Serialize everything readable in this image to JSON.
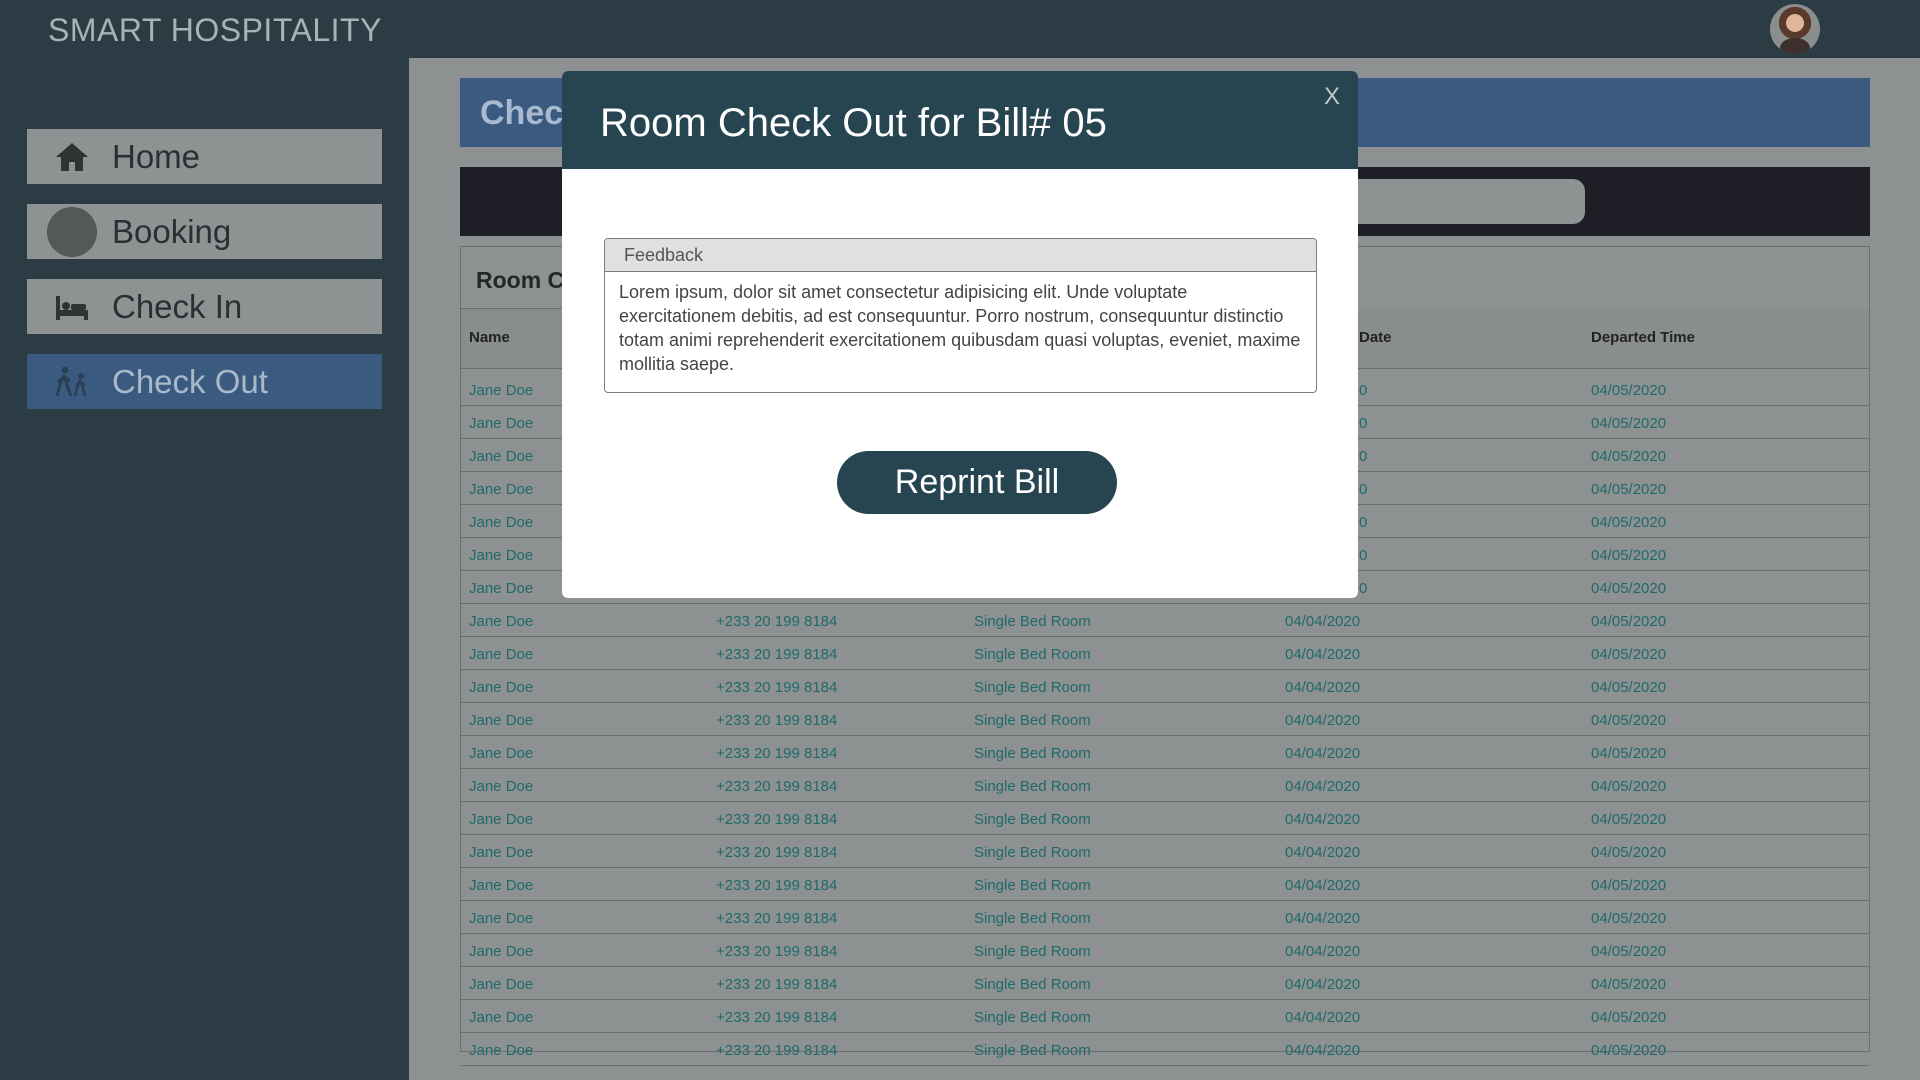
{
  "app": {
    "brand": "SMART HOSPITALITY"
  },
  "sidebar": {
    "items": [
      {
        "label": "Home",
        "icon": "home-icon",
        "active": false
      },
      {
        "label": "Booking",
        "icon": "circle-icon",
        "active": false
      },
      {
        "label": "Check In",
        "icon": "bed-icon",
        "active": false
      },
      {
        "label": "Check Out",
        "icon": "walking-icon",
        "active": true
      }
    ]
  },
  "main": {
    "header_title": "Chec",
    "card_tab": "Room C",
    "columns": [
      "Name",
      "Date",
      "Departed Time"
    ],
    "upper_rows": [
      {
        "name": "Jane Doe",
        "date_fragment": "0",
        "departed": "04/05/2020"
      },
      {
        "name": "Jane Doe",
        "date_fragment": "0",
        "departed": "04/05/2020"
      },
      {
        "name": "Jane Doe",
        "date_fragment": "0",
        "departed": "04/05/2020"
      },
      {
        "name": "Jane Doe",
        "date_fragment": "0",
        "departed": "04/05/2020"
      },
      {
        "name": "Jane Doe",
        "date_fragment": "0",
        "departed": "04/05/2020"
      },
      {
        "name": "Jane Doe",
        "date_fragment": "0",
        "departed": "04/05/2020"
      },
      {
        "name": "Jane Doe",
        "date_fragment": "0",
        "departed": "04/05/2020"
      }
    ],
    "rows": [
      {
        "name": "Jane Doe",
        "phone": "+233 20 199 8184",
        "room": "Single Bed Room",
        "date": "04/04/2020",
        "departed": "04/05/2020"
      },
      {
        "name": "Jane Doe",
        "phone": "+233 20 199 8184",
        "room": "Single Bed Room",
        "date": "04/04/2020",
        "departed": "04/05/2020"
      },
      {
        "name": "Jane Doe",
        "phone": "+233 20 199 8184",
        "room": "Single Bed Room",
        "date": "04/04/2020",
        "departed": "04/05/2020"
      },
      {
        "name": "Jane Doe",
        "phone": "+233 20 199 8184",
        "room": "Single Bed Room",
        "date": "04/04/2020",
        "departed": "04/05/2020"
      },
      {
        "name": "Jane Doe",
        "phone": "+233 20 199 8184",
        "room": "Single Bed Room",
        "date": "04/04/2020",
        "departed": "04/05/2020"
      },
      {
        "name": "Jane Doe",
        "phone": "+233 20 199 8184",
        "room": "Single Bed Room",
        "date": "04/04/2020",
        "departed": "04/05/2020"
      },
      {
        "name": "Jane Doe",
        "phone": "+233 20 199 8184",
        "room": "Single Bed Room",
        "date": "04/04/2020",
        "departed": "04/05/2020"
      },
      {
        "name": "Jane Doe",
        "phone": "+233 20 199 8184",
        "room": "Single Bed Room",
        "date": "04/04/2020",
        "departed": "04/05/2020"
      },
      {
        "name": "Jane Doe",
        "phone": "+233 20 199 8184",
        "room": "Single Bed Room",
        "date": "04/04/2020",
        "departed": "04/05/2020"
      },
      {
        "name": "Jane Doe",
        "phone": "+233 20 199 8184",
        "room": "Single Bed Room",
        "date": "04/04/2020",
        "departed": "04/05/2020"
      },
      {
        "name": "Jane Doe",
        "phone": "+233 20 199 8184",
        "room": "Single Bed Room",
        "date": "04/04/2020",
        "departed": "04/05/2020"
      },
      {
        "name": "Jane Doe",
        "phone": "+233 20 199 8184",
        "room": "Single Bed Room",
        "date": "04/04/2020",
        "departed": "04/05/2020"
      },
      {
        "name": "Jane Doe",
        "phone": "+233 20 199 8184",
        "room": "Single Bed Room",
        "date": "04/04/2020",
        "departed": "04/05/2020"
      },
      {
        "name": "Jane Doe",
        "phone": "+233 20 199 8184",
        "room": "Single Bed Room",
        "date": "04/04/2020",
        "departed": "04/05/2020"
      }
    ]
  },
  "modal": {
    "title": "Room Check Out for Bill# 05",
    "close": "X",
    "feedback_label": "Feedback",
    "feedback_text": "Lorem ipsum, dolor sit amet consectetur adipisicing elit. Unde voluptate exercitationem debitis, ad est consequuntur. Porro nostrum, consequuntur distinctio totam animi reprehenderit exercitationem quibusdam quasi voluptas, eveniet, maxime mollitia saepe.",
    "reprint_label": "Reprint Bill"
  },
  "colors": {
    "sidebar_bg": "#2b3c45",
    "active_nav": "#3b5a80",
    "modal_header": "#264551",
    "table_text": "#1f6a6a"
  }
}
